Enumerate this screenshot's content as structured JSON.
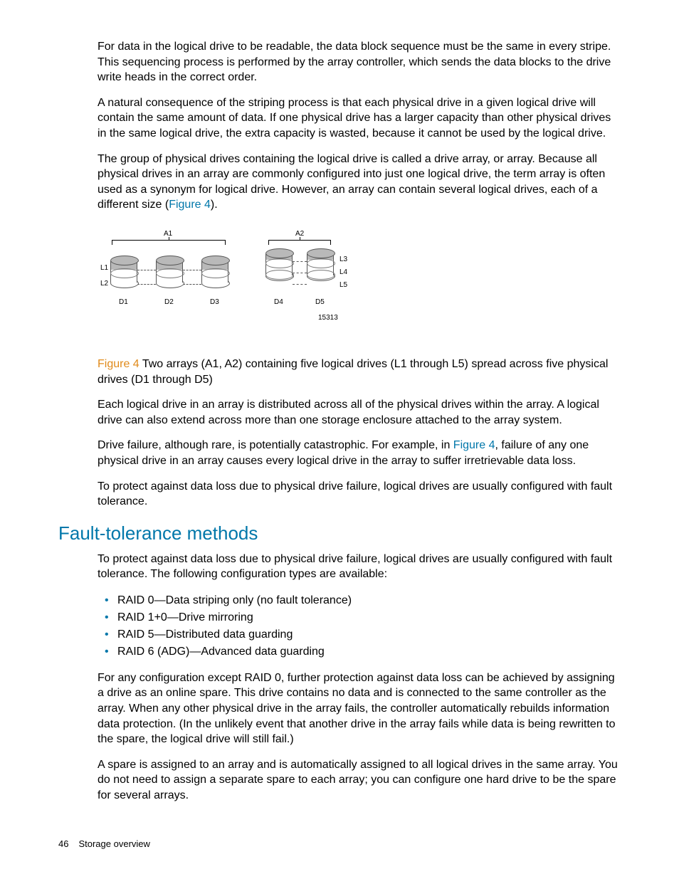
{
  "paragraphs": {
    "p1": "For data in the logical drive to be readable, the data block sequence must be the same in every stripe. This sequencing process is performed by the array controller, which sends the data blocks to the drive write heads in the correct order.",
    "p2": "A natural consequence of the striping process is that each physical drive in a given logical drive will contain the same amount of data. If one physical drive has a larger capacity than other physical drives in the same logical drive, the extra capacity is wasted, because it cannot be used by the logical drive.",
    "p3a": "The group of physical drives containing the logical drive is called a drive array, or array. Because all physical drives in an array are commonly configured into just one logical drive, the term array is often used as a synonym for logical drive. However, an array can contain several logical drives, each of a different size (",
    "p3link": "Figure 4",
    "p3b": ").",
    "fig_label": "Figure 4",
    "fig_caption": " Two arrays (A1, A2) containing five logical drives (L1 through L5) spread across five physical drives (D1 through D5)",
    "p4": "Each logical drive in an array is distributed across all of the physical drives within the array. A logical drive can also extend across more than one storage enclosure attached to the array system.",
    "p5a": "Drive failure, although rare, is potentially catastrophic. For example, in ",
    "p5link": "Figure 4",
    "p5b": ", failure of any one physical drive in an array causes every logical drive in the array to suffer irretrievable data loss.",
    "p6": "To protect against data loss due to physical drive failure, logical drives are usually configured with fault tolerance.",
    "p7": "To protect against data loss due to physical drive failure, logical drives are usually configured with fault tolerance. The following configuration types are available:",
    "p8": "For any configuration except RAID 0, further protection against data loss can be achieved by assigning a drive as an online spare. This drive contains no data and is connected to the same controller as the array. When any other physical drive in the array fails, the controller automatically rebuilds information data protection. (In the unlikely event that another drive in the array fails while data is being rewritten to the spare, the logical drive will still fail.)",
    "p9": "A spare is assigned to an array and is automatically assigned to all logical drives in the same array. You do not need to assign a separate spare to each array; you can configure one hard drive to be the spare for several arrays."
  },
  "heading": "Fault-tolerance methods",
  "raid_list": [
    "RAID 0—Data striping only (no fault tolerance)",
    "RAID 1+0—Drive mirroring",
    "RAID 5—Distributed data guarding",
    "RAID 6 (ADG)—Advanced data guarding"
  ],
  "figure": {
    "arrays": [
      "A1",
      "A2"
    ],
    "logical_left": [
      "L1",
      "L2"
    ],
    "logical_right": [
      "L3",
      "L4",
      "L5"
    ],
    "drives": [
      "D1",
      "D2",
      "D3",
      "D4",
      "D5"
    ],
    "ref": "15313"
  },
  "footer": {
    "page": "46",
    "title": "Storage overview"
  }
}
